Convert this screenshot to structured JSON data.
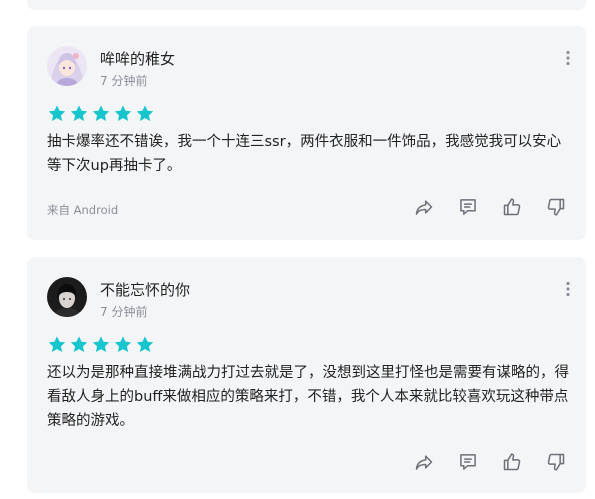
{
  "reviews": [
    {
      "username": "哞哞的稚女",
      "time": "7 分钟前",
      "rating": 5,
      "content": "抽卡爆率还不错诶，我一个十连三ssr，两件衣服和一件饰品，我感觉我可以安心等下次up再抽卡了。",
      "source": "来自 Android"
    },
    {
      "username": "不能忘怀的你",
      "time": "7 分钟前",
      "rating": 5,
      "content": "还以为是那种直接堆满战力打过去就是了，没想到这里打怪也是需要有谋略的，得看敌人身上的buff来做相应的策略来打，不错，我个人本来就比较喜欢玩这种带点策略的游戏。"
    }
  ],
  "icons": {
    "star": "star-icon",
    "more": "more-vertical-icon",
    "share": "share-icon",
    "comment": "comment-icon",
    "like": "thumbs-up-icon",
    "dislike": "thumbs-down-icon"
  },
  "colors": {
    "star": "#17c5cc",
    "card_bg": "#f4f5f7",
    "icon": "#6b7079",
    "secondary_text": "#8a8f98"
  }
}
